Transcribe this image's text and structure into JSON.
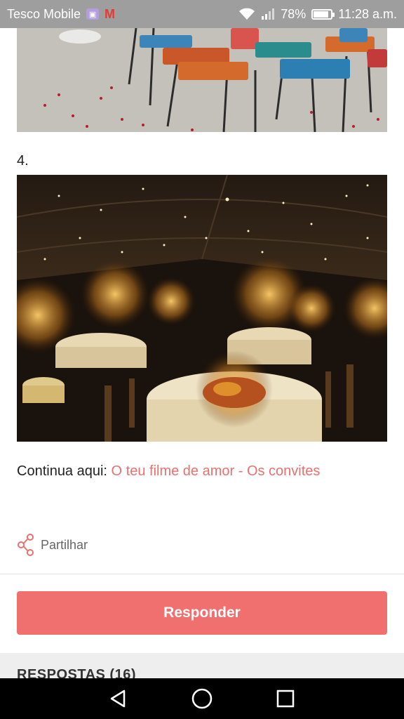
{
  "status_bar": {
    "carrier": "Tesco Mobile",
    "battery_percent": "78%",
    "battery_level": 0.78,
    "time": "11:28 a.m."
  },
  "post": {
    "step_label": "4.",
    "continue_prefix": "Continua aqui:",
    "continue_link": "O teu filme de amor - Os convites"
  },
  "actions": {
    "share_label": "Partilhar",
    "reply_label": "Responder"
  },
  "responses": {
    "header": "RESPOSTAS (16)"
  },
  "colors": {
    "accent": "#f0706f",
    "link": "#e8716f",
    "status_bar": "#9e9e9e"
  },
  "icons": {
    "share": "share-icon",
    "back": "back-triangle-icon",
    "home": "home-circle-icon",
    "recents": "recents-square-icon"
  }
}
